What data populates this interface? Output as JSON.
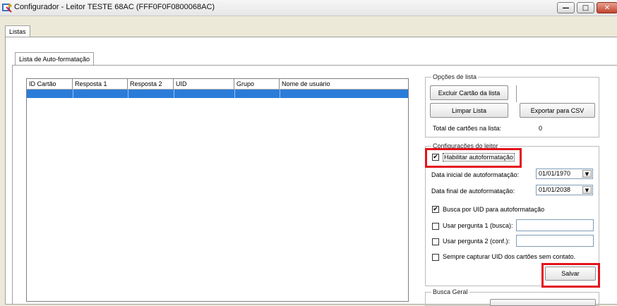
{
  "window": {
    "title": "Configurador - Leitor TESTE 68AC (FFF0F0F0800068AC)",
    "minimize_glyph": "—",
    "maximize_glyph": "□",
    "close_glyph": "✕"
  },
  "tabs": {
    "outer": "Listas",
    "inner": "Lista de Auto-formatação"
  },
  "table": {
    "columns": [
      "ID Cartão",
      "Resposta 1",
      "Resposta 2",
      "UID",
      "Grupo",
      "Nome de usuário"
    ]
  },
  "list_options": {
    "legend": "Opções de lista",
    "delete_card_button": "Excluir Cartão da lista",
    "clear_list_button": "Limpar Lista",
    "export_csv_button": "Exportar para CSV",
    "total_label": "Total de cartões na lista:",
    "total_value": "0"
  },
  "reader_config": {
    "legend": "Configurações do leitor",
    "enable_autoformat": {
      "label": "Habilitar autoformatação",
      "checked": true
    },
    "start_date": {
      "label": "Data inicial de autoformatação:",
      "value": "01/01/1970"
    },
    "end_date": {
      "label": "Data final de autoformatação:",
      "value": "01/01/2038"
    },
    "search_uid": {
      "label": "Busca por UID para autoformatação",
      "checked": true
    },
    "use_q1": {
      "label": "Usar pergunta 1 (busca):",
      "checked": false,
      "value": ""
    },
    "use_q2": {
      "label": "Usar pergunta 2 (conf.):",
      "checked": false,
      "value": ""
    },
    "capture_uid": {
      "label": "Sempre capturar UID dos cartões sem contato.",
      "checked": false
    },
    "save_button": "Salvar"
  },
  "general_search": {
    "legend": "Busca Geral"
  },
  "colors": {
    "highlight": "#e4121c",
    "selection": "#2b7cd9"
  }
}
